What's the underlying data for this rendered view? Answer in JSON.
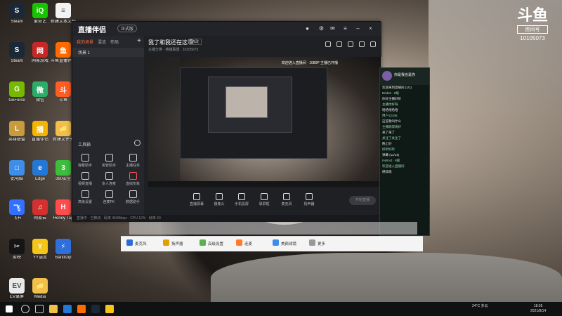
{
  "desktop": {
    "icons": [
      {
        "label": "Steam",
        "color": "#1b2838",
        "glyph": "S"
      },
      {
        "label": "爱奇艺",
        "color": "#16c400",
        "glyph": "iQ"
      },
      {
        "label": "新建文本文档",
        "color": "#f2f2f2",
        "glyph": "≡"
      },
      {
        "label": "Steam",
        "color": "#1b2838",
        "glyph": "S"
      },
      {
        "label": "网易游戏",
        "color": "#c62828",
        "glyph": "网"
      },
      {
        "label": "斗鱼直播伴侣",
        "color": "#ff6b00",
        "glyph": "鱼"
      },
      {
        "label": "GeForce",
        "color": "#76b900",
        "glyph": "G"
      },
      {
        "label": "微信",
        "color": "#2aae67",
        "glyph": "微"
      },
      {
        "label": "斗鱼",
        "color": "#ff5d23",
        "glyph": "斗"
      },
      {
        "label": "英雄联盟",
        "color": "#c89b3c",
        "glyph": "L"
      },
      {
        "label": "直播伴侣",
        "color": "#f6b400",
        "glyph": "播"
      },
      {
        "label": "新建文件夹",
        "color": "#f0c048",
        "glyph": "📁"
      },
      {
        "label": "此电脑",
        "color": "#3d8ee8",
        "glyph": "□"
      },
      {
        "label": "Edge",
        "color": "#2477d4",
        "glyph": "e"
      },
      {
        "label": "360安全",
        "color": "#3cbd3c",
        "glyph": "3"
      },
      {
        "label": "飞书",
        "color": "#3370ff",
        "glyph": "飞"
      },
      {
        "label": "网易云",
        "color": "#d3302f",
        "glyph": "♫"
      },
      {
        "label": "Honey Tap",
        "color": "#ff4d4d",
        "glyph": "H"
      },
      {
        "label": "剪映",
        "color": "#151515",
        "glyph": "✂"
      },
      {
        "label": "YY语音",
        "color": "#f5c518",
        "glyph": "Y"
      },
      {
        "label": "Bandizip",
        "color": "#2f6fdb",
        "glyph": "⚡"
      },
      {
        "label": "EV录屏",
        "color": "#e9e9e9",
        "glyph": "EV"
      },
      {
        "label": "Media",
        "color": "#f0c048",
        "glyph": "📁"
      }
    ]
  },
  "watermark": {
    "logo": "斗鱼",
    "tag": "房间号",
    "room": "10105073"
  },
  "app": {
    "brand": "直播伴侣",
    "version": "正式版",
    "left_tabs": [
      "我的场景",
      "混流",
      "布局"
    ],
    "scene_name": "场景 1",
    "tools_title": "工具箱",
    "tools": [
      {
        "label": "弹幕助手",
        "red": false
      },
      {
        "label": "房管助手",
        "red": false
      },
      {
        "label": "主播任务",
        "red": false
      },
      {
        "label": "视频直播",
        "red": false
      },
      {
        "label": "多人连麦",
        "red": false
      },
      {
        "label": "虚拟形象",
        "red": true
      },
      {
        "label": "高级设置",
        "red": false
      },
      {
        "label": "连麦PK",
        "red": false
      },
      {
        "label": "数据助手",
        "red": false
      }
    ],
    "room_title": "我了和我还在这看",
    "room_badge": "修改",
    "room_meta": "主播分类 · 英雄联盟 · 10105073",
    "preview_note": "欢迎进入直播间 · 1080P 主播已开播",
    "bottom_buttons": [
      "直播屏幕",
      "摄像头",
      "手机投屏",
      "录屏框",
      "麦克风",
      "扬声器"
    ],
    "start_label": "开始直播",
    "status": "直播中 · 已推流 · 码率 4500kbps · CPU 12% · 帧率 60"
  },
  "chat": {
    "name": "你是我也是你",
    "messages": [
      {
        "t": "欢迎来到直播间 (1/1)",
        "w": true
      },
      {
        "t": "Bride0 · 8级",
        "w": false
      },
      {
        "t": "你好主播好听",
        "w": true
      },
      {
        "t": "主播你好呀",
        "w": false
      },
      {
        "t": "哈哈哈哈哈",
        "w": true
      },
      {
        "t": "用户12345",
        "w": false
      },
      {
        "t": "这首歌叫什么",
        "w": true
      },
      {
        "t": "主播唱得真好",
        "w": false
      },
      {
        "t": "来了来了",
        "w": true
      },
      {
        "t": "关注了关注了",
        "w": false
      },
      {
        "t": "晚上好",
        "w": true
      },
      {
        "t": "好听好听",
        "w": false
      },
      {
        "t": "弹幕 (11/14)",
        "w": true
      },
      {
        "t": "Instinct · 8级",
        "w": false
      },
      {
        "t": "欢迎进入直播间",
        "w": false
      },
      {
        "t": "继续唱",
        "w": true
      }
    ]
  },
  "strip": {
    "items": [
      {
        "label": "麦克风",
        "color": "#2d6bd8"
      },
      {
        "label": "扬声器",
        "color": "#e0a100"
      },
      {
        "label": "高级设置",
        "color": "#5bb052"
      },
      {
        "label": "连麦",
        "color": "#ff7a2a"
      },
      {
        "label": "美颜滤镜",
        "color": "#3d8ee8"
      },
      {
        "label": "更多",
        "color": "#999999"
      }
    ]
  },
  "taskbar": {
    "weather": "24°C 多云",
    "time": "18:05",
    "date": "2021/8/14"
  }
}
